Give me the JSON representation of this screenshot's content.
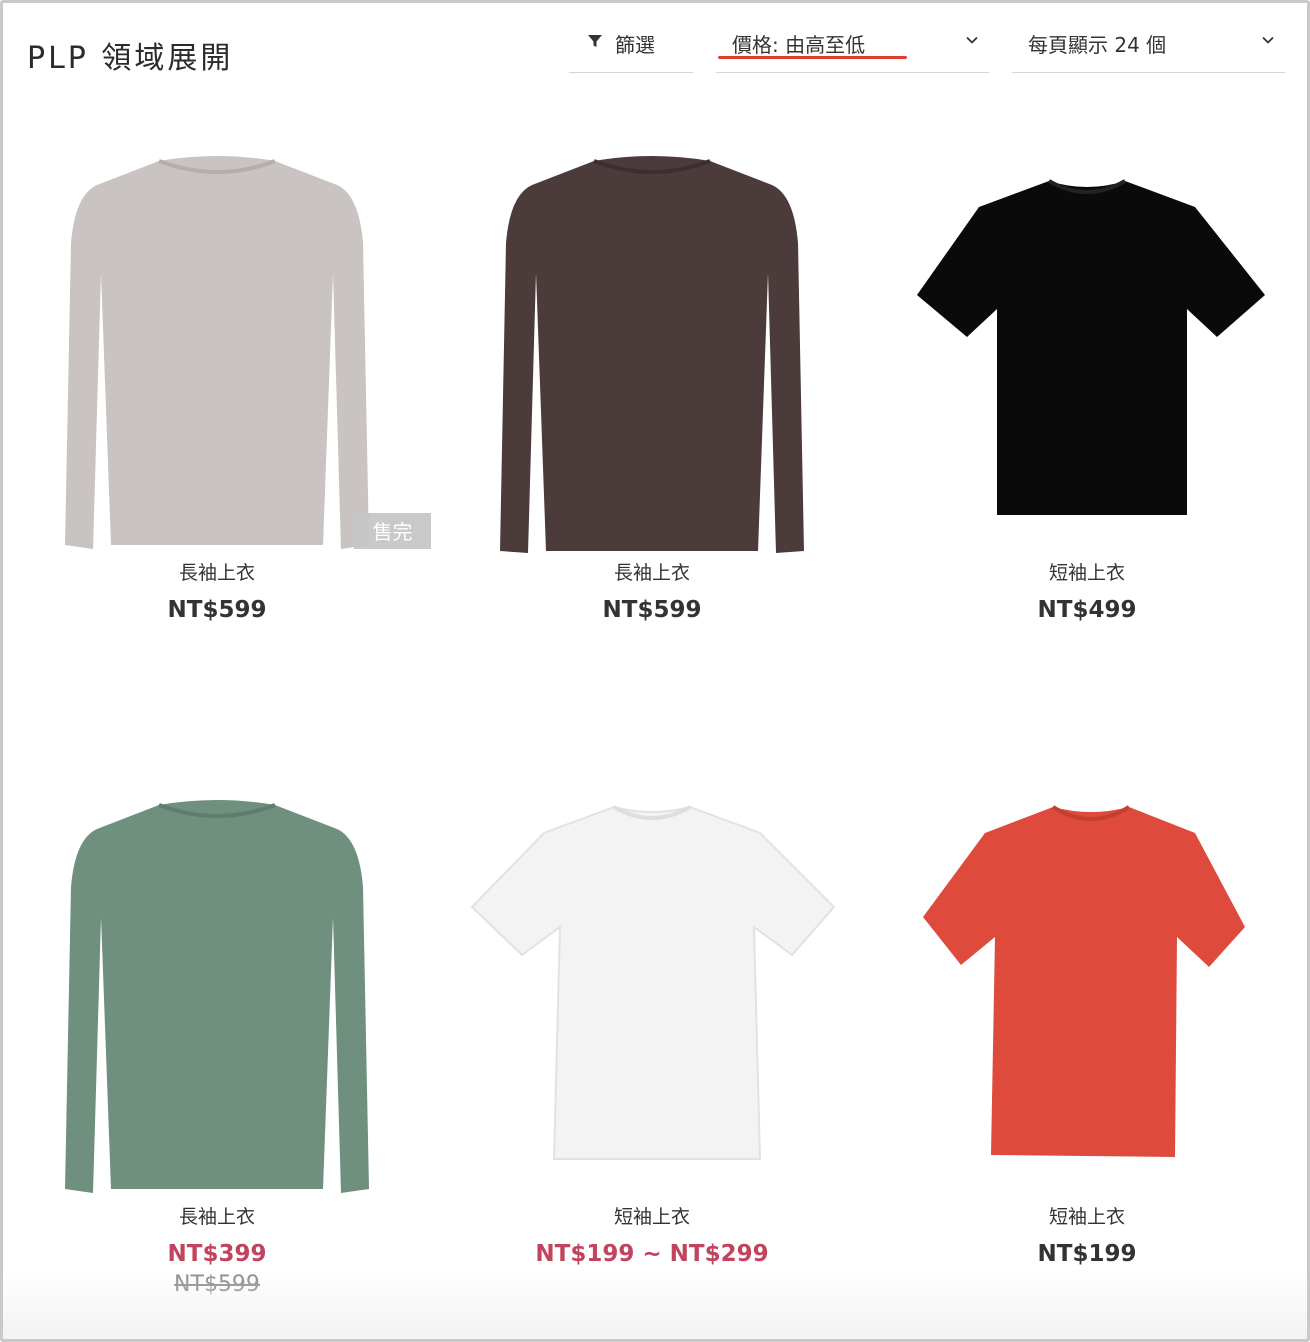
{
  "header": {
    "title": "PLP 領域展開"
  },
  "controls": {
    "filter_label": "篩選",
    "sort_label": "價格: 由高至低",
    "per_page_label": "每頁顯示 24 個"
  },
  "products": [
    {
      "name": "長袖上衣",
      "price": "NT$599",
      "badge": "售完",
      "color": "#c9c3c1"
    },
    {
      "name": "長袖上衣",
      "price": "NT$599",
      "color": "#4b3b3b"
    },
    {
      "name": "短袖上衣",
      "price": "NT$499",
      "color": "#0a0a0a"
    },
    {
      "name": "長袖上衣",
      "sale_price": "NT$399",
      "original_price": "NT$599",
      "color": "#6f8f7f"
    },
    {
      "name": "短袖上衣",
      "sale_price": "NT$199 ~ NT$299",
      "color": "#f3f3f3"
    },
    {
      "name": "短袖上衣",
      "price": "NT$199",
      "color": "#de4b3d"
    }
  ],
  "colors": {
    "accent_underline": "#e03e2d",
    "sale_price": "#c2435e"
  }
}
